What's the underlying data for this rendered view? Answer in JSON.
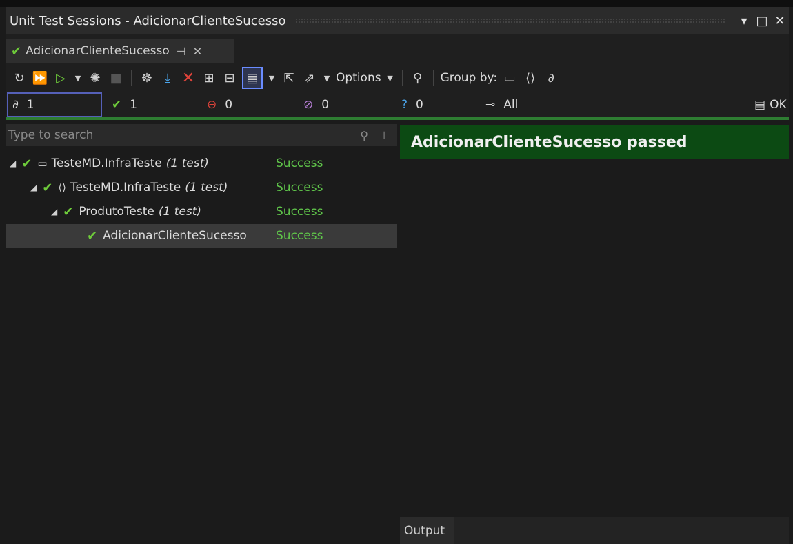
{
  "window": {
    "title": "Unit Test Sessions - AdicionarClienteSucesso",
    "dropdown_glyph": "▾",
    "maximize_glyph": "□",
    "close_glyph": "✕"
  },
  "tab": {
    "label": "AdicionarClienteSucesso",
    "pin_glyph": "⊣",
    "close_glyph": "✕"
  },
  "toolbar": {
    "options_label": "Options",
    "group_by_label": "Group by:",
    "icons": [
      "refresh-icon",
      "run-all-icon",
      "run-icon",
      "dropdown-icon",
      "debug-icon",
      "stop-icon",
      "profile-icon",
      "download-icon",
      "delete-icon",
      "expand-all-icon",
      "collapse-all-icon",
      "layout-icon",
      "import-icon",
      "export-icon",
      "filter-icon",
      "project-group-icon",
      "namespace-group-icon",
      "category-group-icon"
    ]
  },
  "filters": {
    "total": "1",
    "passed": "1",
    "failed": "0",
    "ignored": "0",
    "inconclusive": "0",
    "all_label": "All",
    "ok_label": "OK"
  },
  "search": {
    "placeholder": "Type to search"
  },
  "tree": [
    {
      "name": "TesteMD.InfraTeste",
      "count": "(1 test)",
      "status": "Success",
      "icon": "csharp-project-icon"
    },
    {
      "name": "TesteMD.InfraTeste",
      "count": "(1 test)",
      "status": "Success",
      "icon": "namespace-icon"
    },
    {
      "name": "ProdutoTeste",
      "count": "(1 test)",
      "status": "Success",
      "icon": ""
    },
    {
      "name": "AdicionarClienteSucesso",
      "count": "",
      "status": "Success",
      "icon": ""
    }
  ],
  "details": {
    "header": "AdicionarClienteSucesso passed",
    "output_tab": "Output"
  },
  "colors": {
    "success_green": "#5fc44a",
    "pass_header_bg": "#0c4a13",
    "background": "#1b1b1b"
  }
}
